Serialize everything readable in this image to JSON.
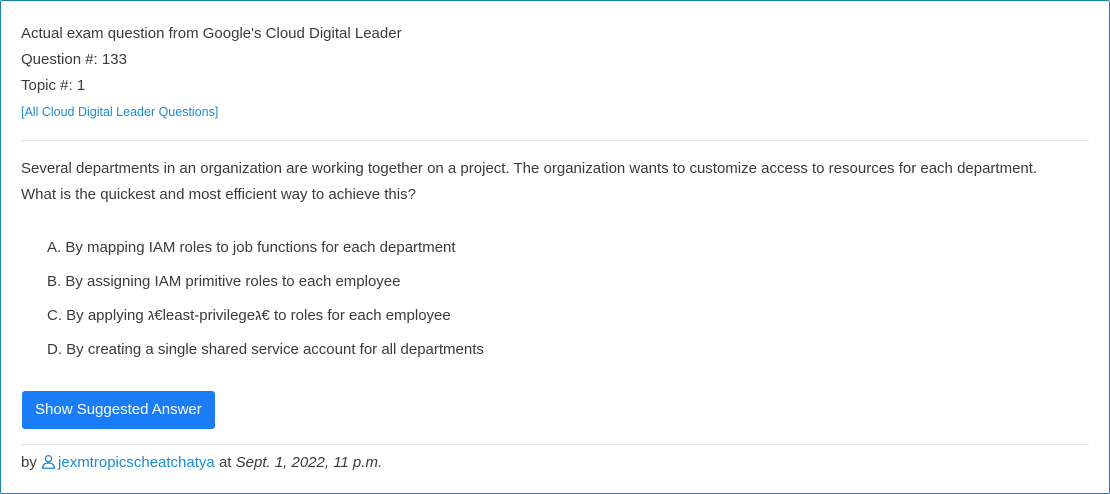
{
  "header": {
    "line1": "Actual exam question from Google's Cloud Digital Leader",
    "question_number": "Question #: 133",
    "topic_number": "Topic #: 1",
    "all_questions_link": "[All Cloud Digital Leader Questions]"
  },
  "question": {
    "line1": "Several departments in an organization are working together on a project. The organization wants to customize access to resources for each department.",
    "line2": "What is the quickest and most efficient way to achieve this?"
  },
  "choices": [
    "A. By mapping IAM roles to job functions for each department",
    "B. By assigning IAM primitive roles to each employee",
    "C. By applying ג€least-privilegeג€ to roles for each employee",
    "D. By creating a single shared service account for all departments"
  ],
  "button": {
    "label": "Show Suggested Answer"
  },
  "footer": {
    "by": "by",
    "user_icon": "user-icon",
    "username": "jexmtropicscheatchatya",
    "at": "at",
    "date": "Sept. 1, 2022, 11 p.m."
  },
  "colors": {
    "accent": "#1a7cf6",
    "link": "#1a8bd6",
    "border": "#1b87a6",
    "text": "#3a3a3a"
  }
}
